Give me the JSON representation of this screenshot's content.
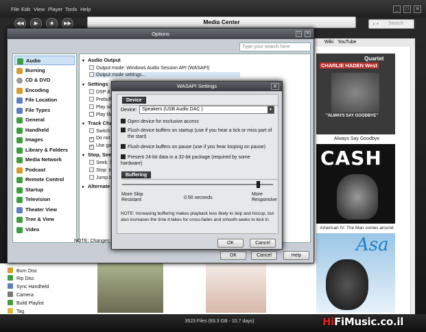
{
  "menubar": {
    "items": [
      "File",
      "Edit",
      "View",
      "Player",
      "Tools",
      "Help"
    ]
  },
  "transport": {
    "prev": "◀◀",
    "play": "▶",
    "stop": "■",
    "next": "▶▶"
  },
  "now_playing": {
    "title": "Media Center"
  },
  "mc_search": {
    "placeholder": "Search"
  },
  "right_pane": {
    "tabs": [
      "Wiki",
      "YouTube"
    ],
    "albums": [
      {
        "artist_line1": "Quartet",
        "artist_line2": "CHARLIE HADEN West",
        "art_text": "\"ALWAYS SAY GOODBYE\"",
        "caption": "Always Say Goodbye"
      },
      {
        "art_text": "CASH",
        "caption": "American IV: The Man comes around"
      },
      {
        "art_text": "Asa",
        "caption": ""
      }
    ]
  },
  "tree_bottom": {
    "items": [
      "Burn Disc",
      "Rip Disc",
      "Sync Handheld",
      "Camera",
      "Build Playlist",
      "Tag"
    ]
  },
  "status": {
    "text": "3523 Files (83.3 GB - 10.7 days)"
  },
  "brand": {
    "prefix": "Hi",
    "suffix": "FiMusic.co.il"
  },
  "options": {
    "title": "Options",
    "search_placeholder": "Type your search here",
    "nav": [
      "Audio",
      "Burning",
      "CD & DVD",
      "Encoding",
      "File Location",
      "File Types",
      "General",
      "Handheld",
      "Images",
      "Library & Folders",
      "Media Network",
      "Podcast",
      "Remote Control",
      "Startup",
      "Television",
      "Theater View",
      "Tree & View",
      "Video"
    ],
    "sections": {
      "audio_output": "Audio Output",
      "output_mode": "Output mode: Windows Audio Session API (WASAPI)",
      "output_mode_settings": "Output mode settings...",
      "settings": "Settings",
      "dsp": "DSP & outp",
      "prebuffering": "Prebufferin",
      "play_silence": "Play silenc",
      "play_files": "Play files f",
      "track_change": "Track Chang",
      "switch_tracks": "Switch trac",
      "do_not_play": "Do not play",
      "use_gapless": "Use gaples",
      "stop_seek": "Stop, Seek &",
      "seek_smooth": "Seek: Smoo",
      "stop_imme": "Stop: Imme",
      "jump_beha": "Jump beha",
      "alternate": "Alternate Mo"
    },
    "note": "NOTE: Changes ta",
    "ok": "OK",
    "cancel": "Cancel",
    "help": "Help"
  },
  "wasapi": {
    "title": "WASAPI Settings",
    "close": "X",
    "device_header": "Device",
    "device_label": "Device:",
    "device_value": "Speakers (USB Audio DAC   )",
    "exclusive": "Open device for exclusive access",
    "flush_startup": "Flush device buffers on startup (use if you hear a tick or miss part of the start)",
    "flush_pause": "Flush device buffers on pause (use if you hear looping on pause)",
    "present_24bit": "Present 24-bit data in a 32-bit package (required by some hardware)",
    "buffering_header": "Buffering",
    "buffer_level": 0.9,
    "left_label": "More Skip Resistant",
    "mid_label": "0.50 seconds",
    "right_label": "More Responsive",
    "note": "NOTE: Increasing buffering makes playback less likely to skip and hiccup, but also increases the time it takes for cross-fades and smooth-seeks to kick in.",
    "ok": "OK",
    "cancel": "Cancel"
  },
  "colors": {
    "accent": "#84acdd",
    "brand_red": "#e02020"
  }
}
